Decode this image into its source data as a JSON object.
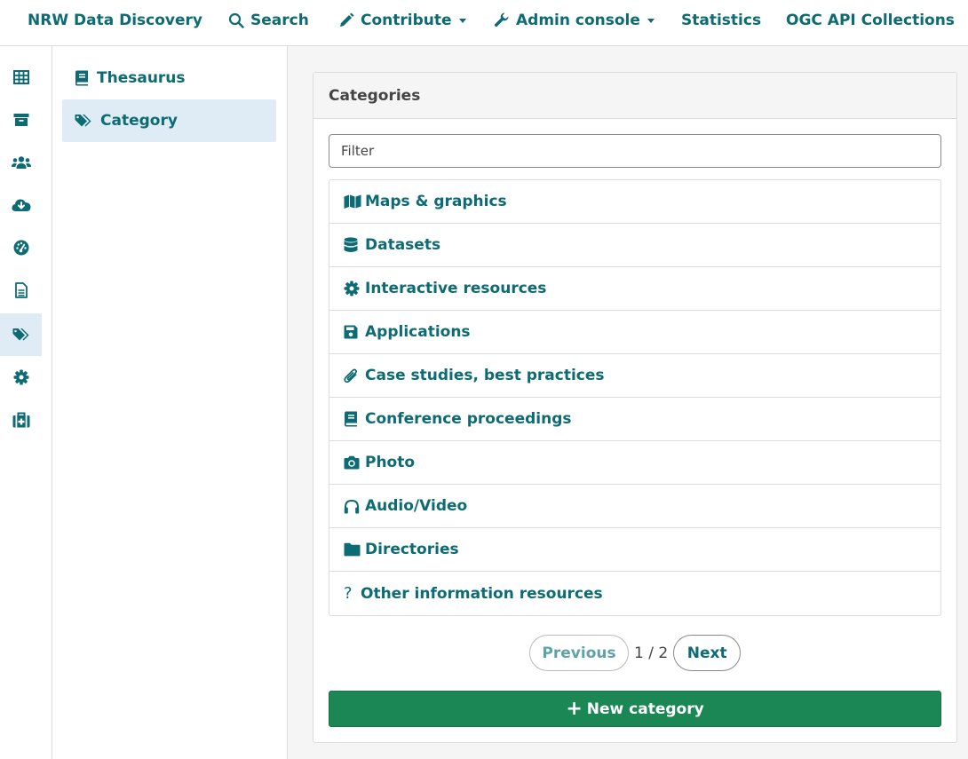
{
  "topnav": {
    "brand": "NRW Data Discovery",
    "search": "Search",
    "contribute": "Contribute",
    "admin_console": "Admin console",
    "statistics": "Statistics",
    "ogc": "OGC API Collections"
  },
  "iconbar": {
    "icons": [
      "table-icon",
      "archive-icon",
      "users-icon",
      "cloud-download-icon",
      "dashboard-icon",
      "file-icon",
      "tags-icon",
      "gear-icon",
      "medkit-icon"
    ],
    "active": "tags-icon"
  },
  "subnav": {
    "items": [
      {
        "label": "Thesaurus",
        "icon": "book-icon"
      },
      {
        "label": "Category",
        "icon": "tags-icon"
      }
    ],
    "active": "Category"
  },
  "panel": {
    "title": "Categories",
    "filter_placeholder": "Filter",
    "items": [
      {
        "label": "Maps & graphics",
        "icon": "map-icon"
      },
      {
        "label": "Datasets",
        "icon": "database-icon"
      },
      {
        "label": "Interactive resources",
        "icon": "gear-icon"
      },
      {
        "label": "Applications",
        "icon": "floppy-icon"
      },
      {
        "label": "Case studies, best practices",
        "icon": "paperclip-icon"
      },
      {
        "label": "Conference proceedings",
        "icon": "book-icon"
      },
      {
        "label": "Photo",
        "icon": "camera-icon"
      },
      {
        "label": "Audio/Video",
        "icon": "headphones-icon"
      },
      {
        "label": "Directories",
        "icon": "folder-icon"
      },
      {
        "label": "Other information resources",
        "icon": "question-icon"
      }
    ],
    "pager": {
      "previous": "Previous",
      "page": "1 / 2",
      "next": "Next"
    },
    "new_button": "New category"
  },
  "colors": {
    "accent": "#0d6b73",
    "primary_button": "#1b8754",
    "active_bg": "#e0ecf5"
  }
}
